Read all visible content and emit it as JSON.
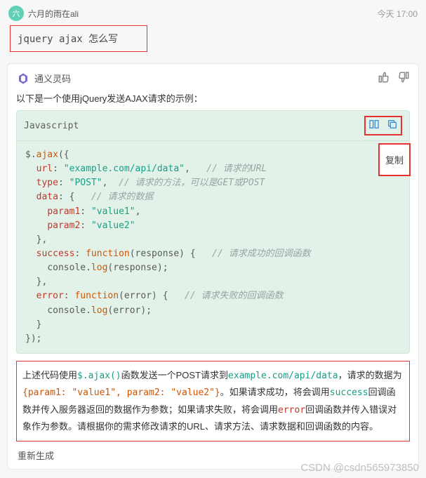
{
  "user": {
    "avatar_text": "六",
    "name": "六月的雨在ali",
    "timestamp": "今天 17:00",
    "question": "jquery ajax 怎么写"
  },
  "ai": {
    "name": "通义灵码",
    "intro": "以下是一个使用jQuery发送AJAX请求的示例：",
    "code_lang": "Javascript",
    "copy_tooltip": "复制",
    "code": {
      "l1_a": "$.",
      "l1_b": "ajax",
      "l1_c": "({",
      "l2_key": "url",
      "l2_str": "\"example.com/api/data\"",
      "l2_cmt": "// 请求的URL",
      "l3_key": "type",
      "l3_str": "\"POST\"",
      "l3_cmt": "// 请求的方法，可以是GET或POST",
      "l4_key": "data",
      "l4_cmt": "// 请求的数据",
      "l5_key": "param1",
      "l5_str": "\"value1\"",
      "l6_key": "param2",
      "l6_str": "\"value2\"",
      "l8_key": "success",
      "l8_kw": "function",
      "l8_sig": "(response) {",
      "l8_cmt": "// 请求成功的回调函数",
      "l9_a": "console.",
      "l9_b": "log",
      "l9_c": "(response);",
      "l11_key": "error",
      "l11_kw": "function",
      "l11_sig": "(error) {",
      "l11_cmt": "// 请求失败的回调函数",
      "l12_a": "console.",
      "l12_b": "log",
      "l12_c": "(error);"
    },
    "explanation": {
      "p1a": "上述代码使用",
      "p1b": "$.ajax()",
      "p1c": "函数发送一个POST请求到",
      "p1d": "example.com/api/data",
      "p1e": "，请求的数据为",
      "p2a": "{param1: \"value1\", param2: \"value2\"}",
      "p2b": "。如果请求成功，将会调用",
      "p2c": "success",
      "p2d": "回调函数并传入服务器返回的数据作为参数；如果请求失败，将会调用",
      "p2e": "error",
      "p2f": "回调函数并传入错误对象作为参数。请根据你的需求修改请求的URL、请求方法、请求数据和回调函数的内容。"
    },
    "regenerate": "重新生成"
  },
  "watermark": "CSDN @csdn565973850"
}
